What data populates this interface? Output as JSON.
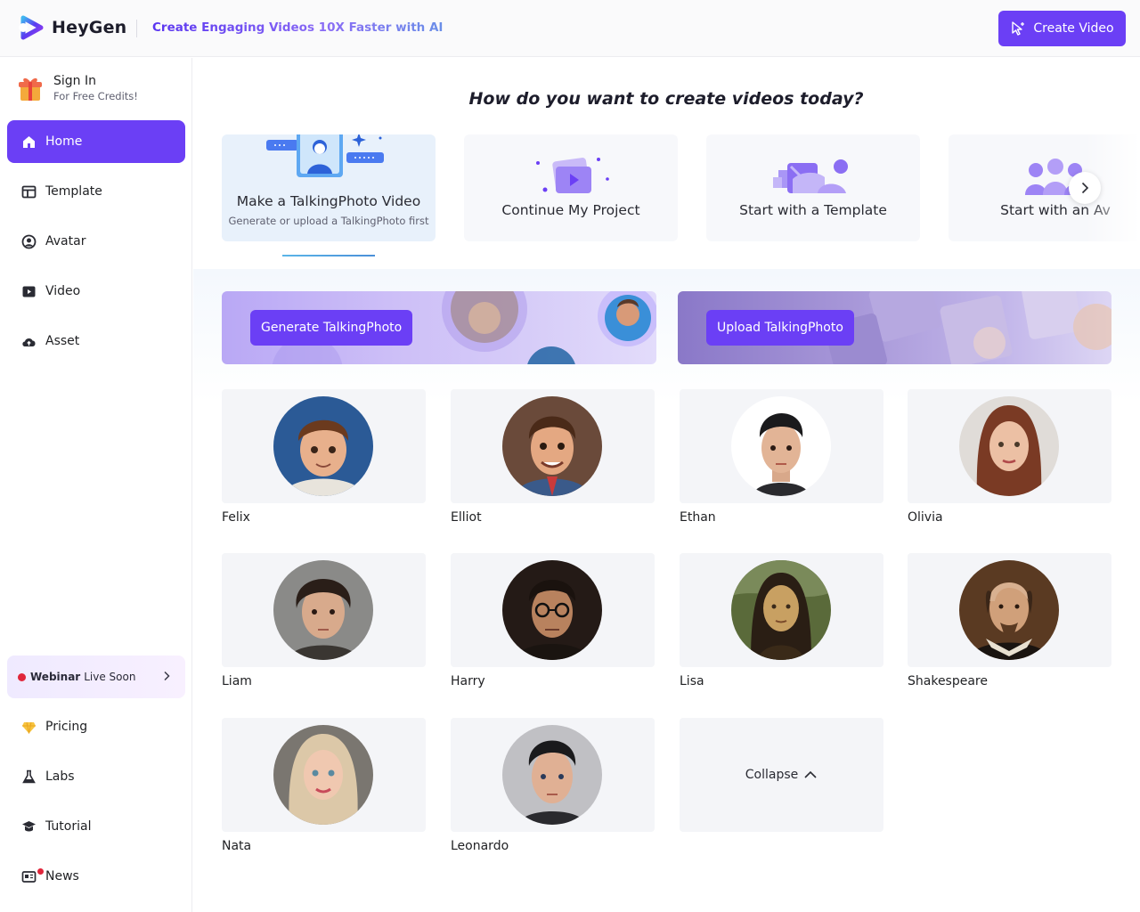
{
  "header": {
    "logo_text": "HeyGen",
    "tagline": "Create Engaging Videos 10X Faster with AI",
    "create_button": "Create Video",
    "accent_color": "#6b3ff5"
  },
  "sidebar": {
    "signin_title": "Sign In",
    "signin_sub": "For Free Credits!",
    "items": [
      {
        "label": "Home",
        "icon": "home-icon",
        "active": true
      },
      {
        "label": "Template",
        "icon": "template-icon"
      },
      {
        "label": "Avatar",
        "icon": "avatar-icon"
      },
      {
        "label": "Video",
        "icon": "video-icon"
      },
      {
        "label": "Asset",
        "icon": "cloud-upload-icon"
      }
    ],
    "webinar_bold": "Webinar",
    "webinar_text": "Live Soon",
    "bottom_items": [
      {
        "label": "Pricing",
        "icon": "diamond-icon"
      },
      {
        "label": "Labs",
        "icon": "flask-icon"
      },
      {
        "label": "Tutorial",
        "icon": "graduation-cap-icon"
      },
      {
        "label": "News",
        "icon": "newspaper-icon"
      }
    ]
  },
  "main": {
    "title": "How do you want to create videos today?",
    "options": [
      {
        "label": "Make a TalkingPhoto Video",
        "sub": "Generate or upload a TalkingPhoto first"
      },
      {
        "label": "Continue My Project"
      },
      {
        "label": "Start with a Template"
      },
      {
        "label": "Start with an Av"
      }
    ],
    "banners": {
      "generate": "Generate TalkingPhoto",
      "upload": "Upload TalkingPhoto"
    },
    "avatars": [
      "Felix",
      "Elliot",
      "Ethan",
      "Olivia",
      "Liam",
      "Harry",
      "Lisa",
      "Shakespeare",
      "Nata",
      "Leonardo"
    ],
    "collapse_label": "Collapse"
  }
}
